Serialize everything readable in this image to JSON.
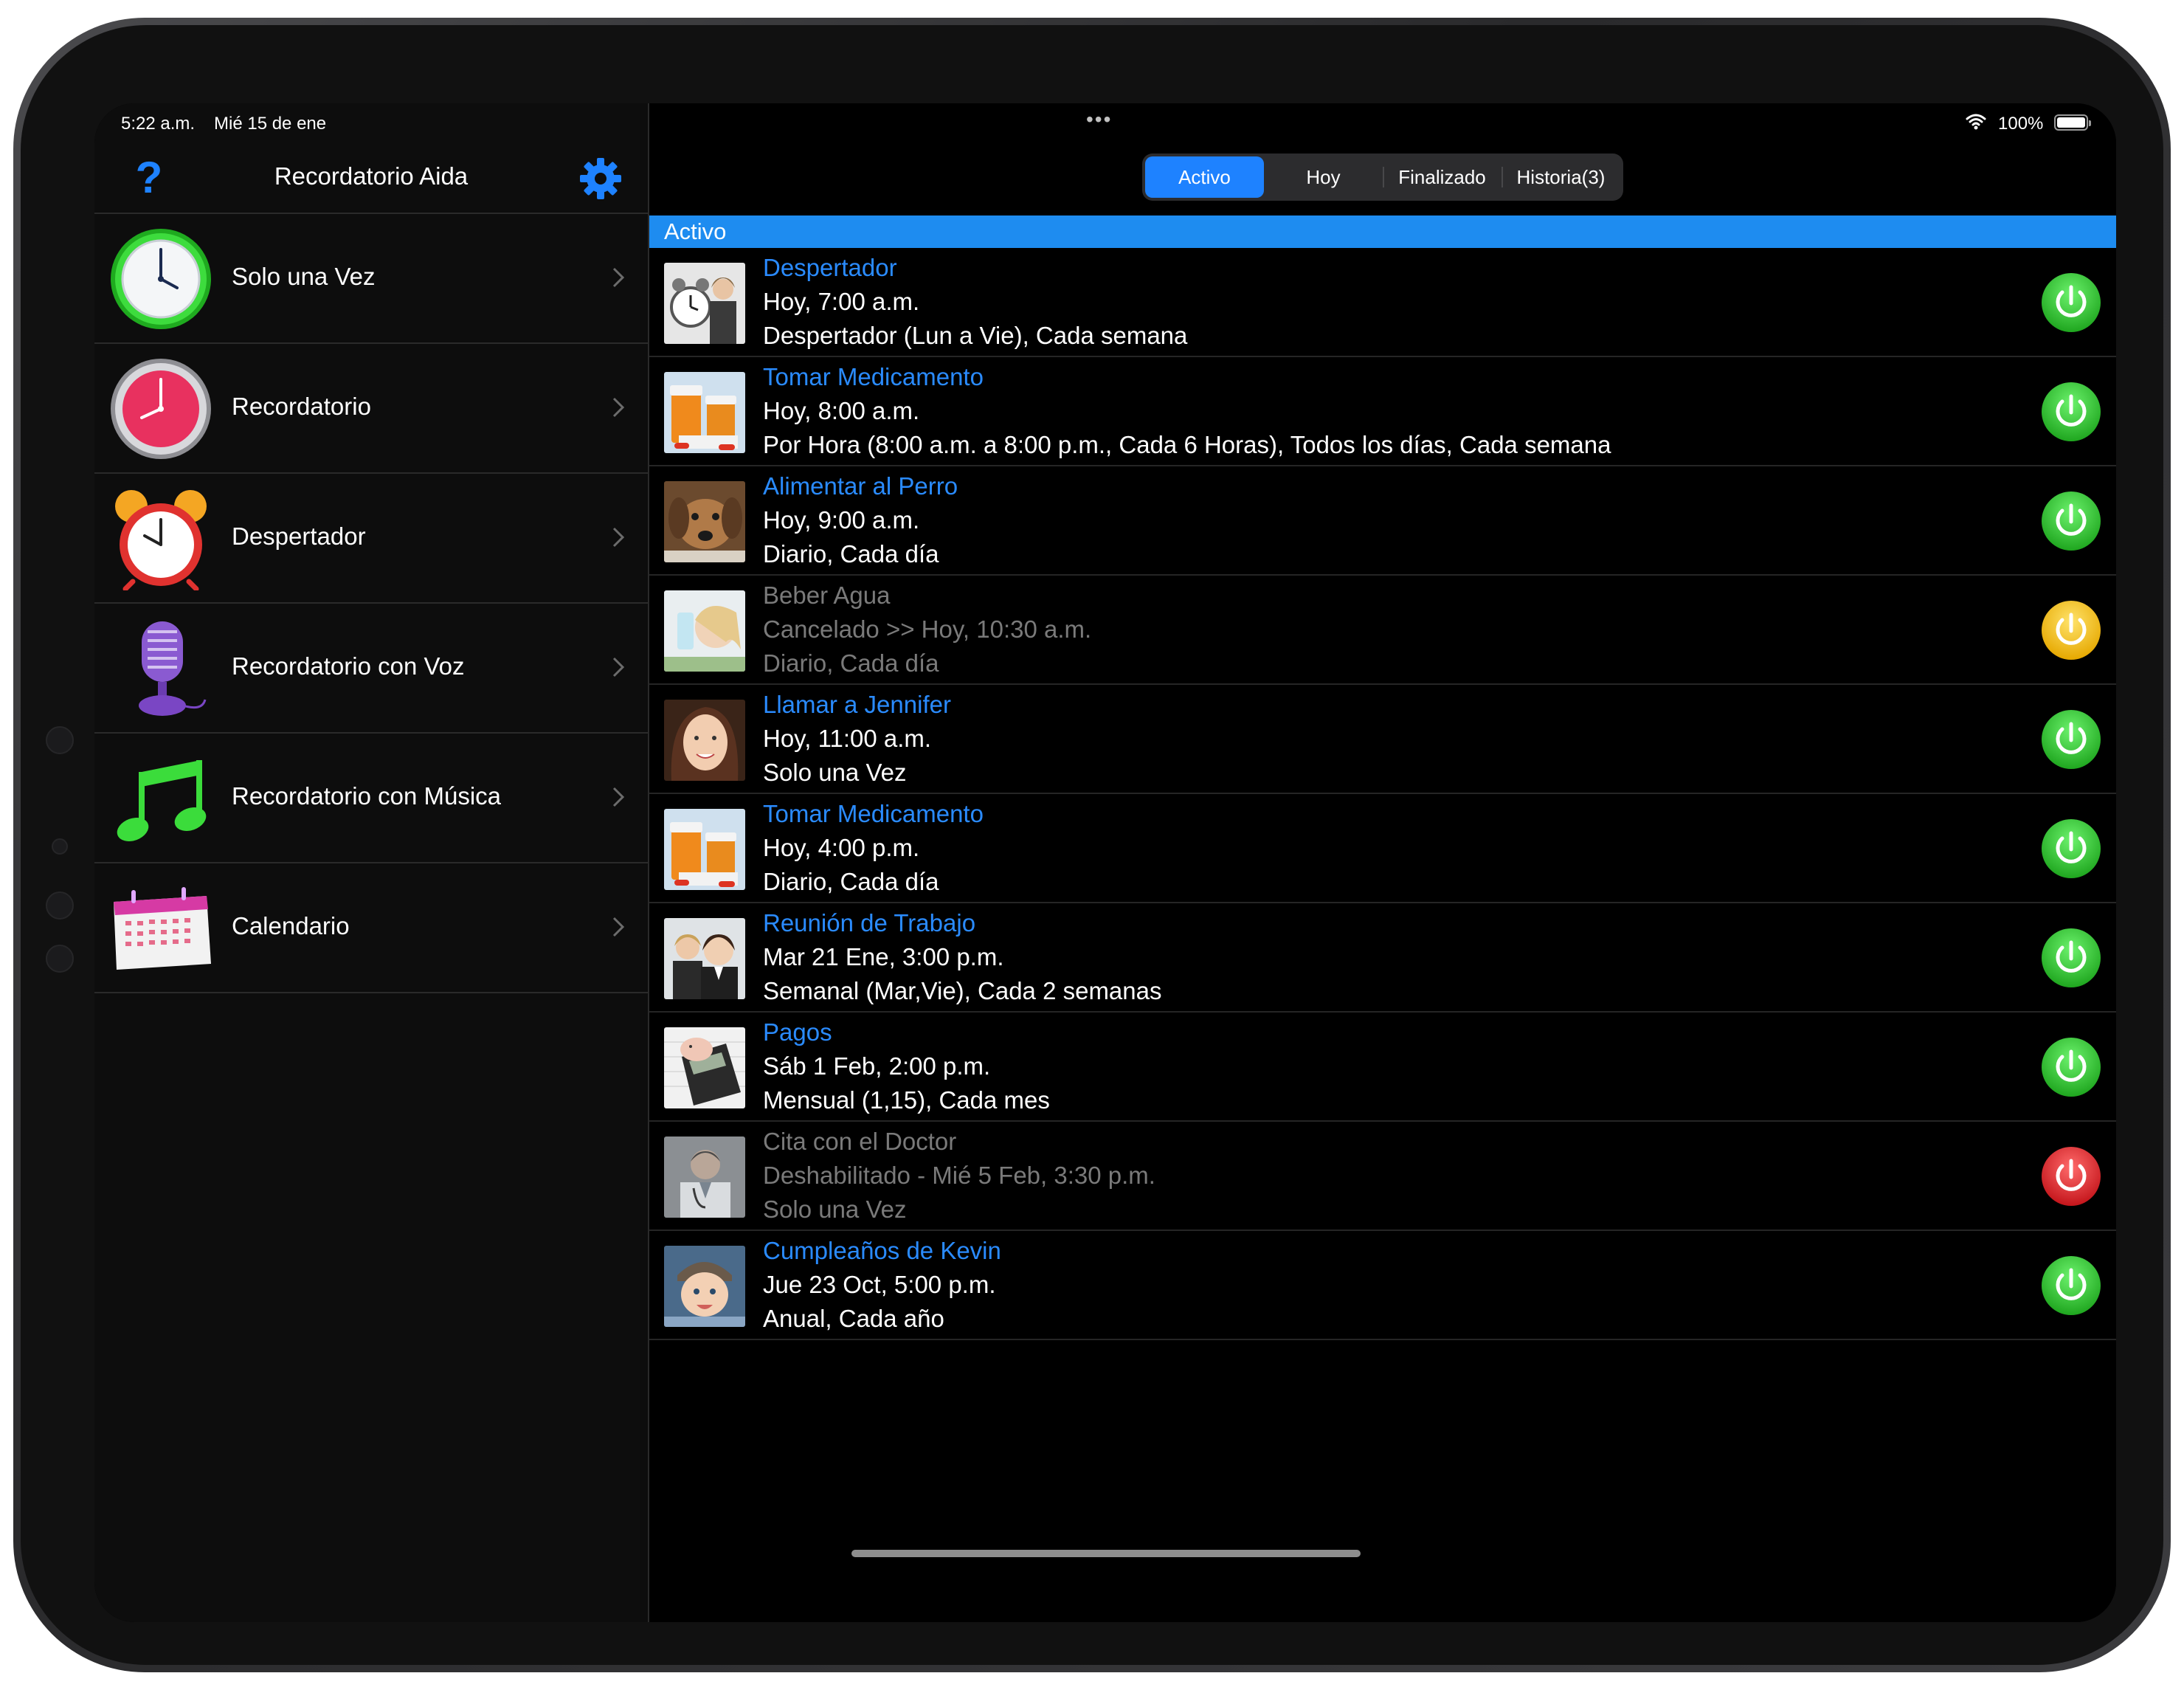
{
  "status_bar": {
    "time": "5:22 a.m.",
    "date": "Mié 15 de ene",
    "battery": "100%"
  },
  "sidebar": {
    "title": "Recordatorio Aida",
    "items": [
      {
        "label": "Solo una Vez",
        "icon": "green-clock-icon"
      },
      {
        "label": "Recordatorio",
        "icon": "pink-clock-icon"
      },
      {
        "label": "Despertador",
        "icon": "alarm-clock-icon"
      },
      {
        "label": "Recordatorio con Voz",
        "icon": "microphone-icon"
      },
      {
        "label": "Recordatorio con Música",
        "icon": "music-note-icon"
      },
      {
        "label": "Calendario",
        "icon": "calendar-icon"
      }
    ]
  },
  "tabs": [
    {
      "label": "Activo",
      "active": true
    },
    {
      "label": "Hoy",
      "active": false
    },
    {
      "label": "Finalizado",
      "active": false
    },
    {
      "label": "Historia(3)",
      "active": false
    }
  ],
  "section_title": "Activo",
  "reminders": [
    {
      "title": "Despertador",
      "line2": "Hoy, 7:00 a.m.",
      "line3": "Despertador (Lun a Vie), Cada semana",
      "status": "enabled",
      "thumb": "alarm-photo"
    },
    {
      "title": "Tomar Medicamento",
      "line2": "Hoy, 8:00 a.m.",
      "line3": "Por Hora (8:00 a.m. a 8:00 p.m., Cada 6 Horas), Todos los días, Cada semana",
      "status": "enabled",
      "thumb": "pills-photo"
    },
    {
      "title": "Alimentar al Perro",
      "line2": "Hoy, 9:00 a.m.",
      "line3": "Diario, Cada día",
      "status": "enabled",
      "thumb": "dog-photo"
    },
    {
      "title": "Beber Agua",
      "line2": "Cancelado >> Hoy, 10:30 a.m.",
      "line3": "Diario, Cada día",
      "status": "cancelled",
      "thumb": "water-photo"
    },
    {
      "title": "Llamar a Jennifer",
      "line2": "Hoy, 11:00 a.m.",
      "line3": "Solo una Vez",
      "status": "enabled",
      "thumb": "woman-photo"
    },
    {
      "title": "Tomar Medicamento",
      "line2": "Hoy, 4:00 p.m.",
      "line3": "Diario, Cada día",
      "status": "enabled",
      "thumb": "pills-photo"
    },
    {
      "title": "Reunión de Trabajo",
      "line2": "Mar 21 Ene, 3:00 p.m.",
      "line3": "Semanal (Mar,Vie), Cada 2 semanas",
      "status": "enabled",
      "thumb": "meeting-photo"
    },
    {
      "title": "Pagos",
      "line2": "Sáb 1 Feb, 2:00 p.m.",
      "line3": "Mensual (1,15), Cada mes",
      "status": "enabled",
      "thumb": "calculator-photo"
    },
    {
      "title": "Cita con el Doctor",
      "line2": "Deshabilitado - Mié 5 Feb, 3:30 p.m.",
      "line3": "Solo una Vez",
      "status": "disabled",
      "thumb": "doctor-photo"
    },
    {
      "title": "Cumpleaños de Kevin",
      "line2": "Jue 23 Oct, 5:00 p.m.",
      "line3": "Anual, Cada año",
      "status": "enabled",
      "thumb": "baby-photo"
    }
  ],
  "colors": {
    "accent": "#1e82ff",
    "section_bar": "#1e8cf0",
    "title_link": "#2a8bff",
    "enabled": "#2fc72f",
    "cancelled": "#f5c518",
    "disabled": "#e3262b"
  }
}
